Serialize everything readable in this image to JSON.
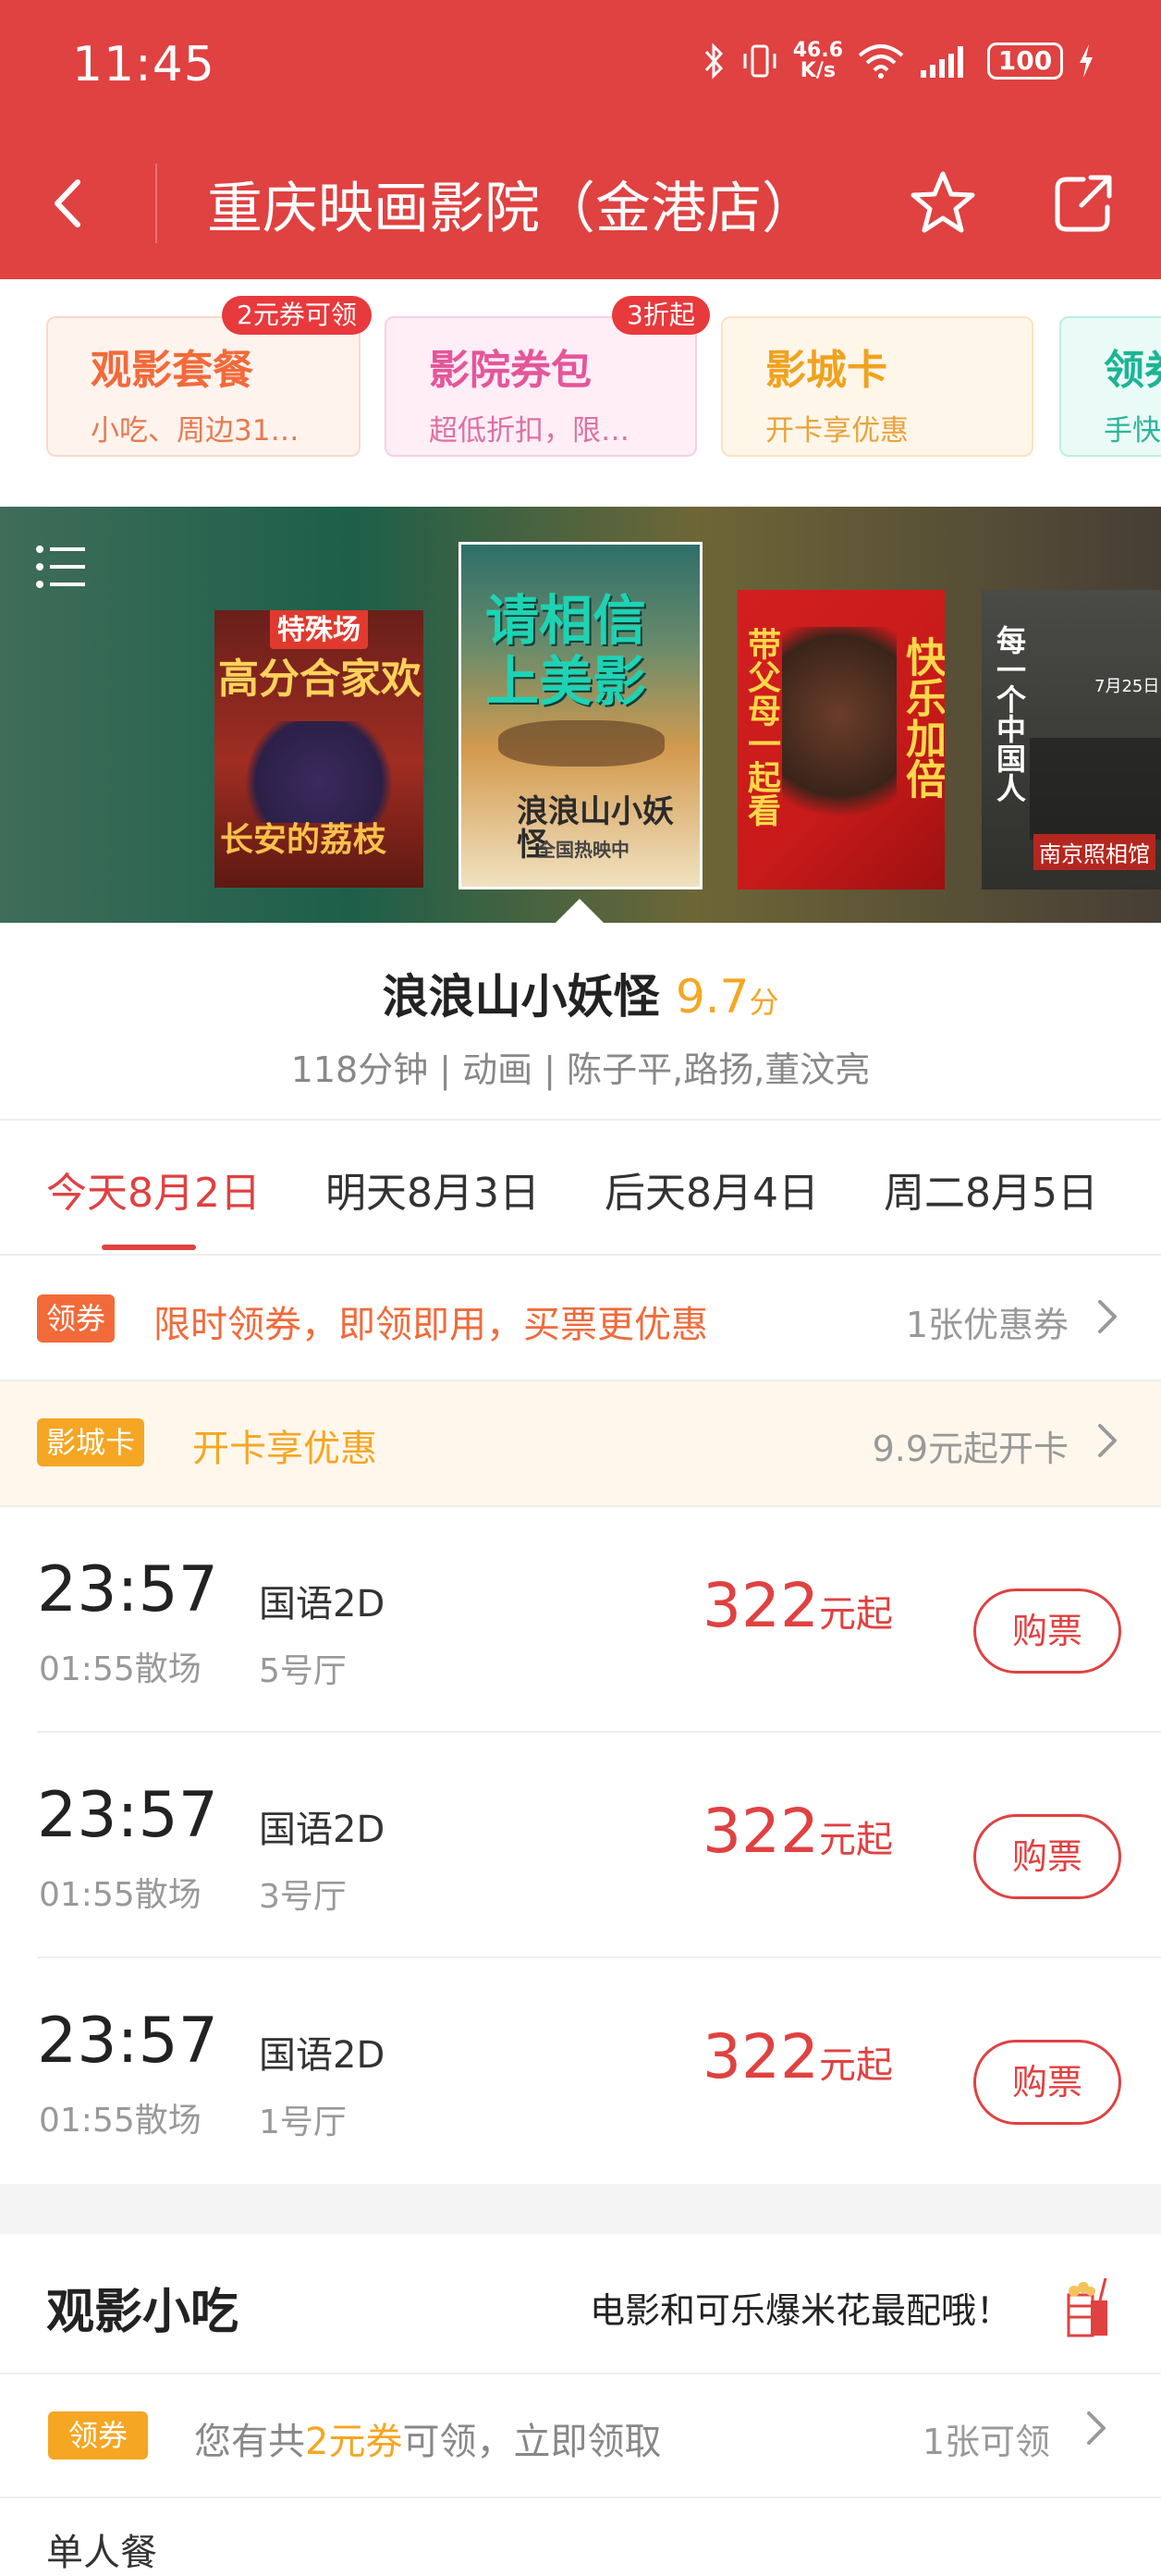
{
  "status": {
    "time": "11:45",
    "net_speed_top": "46.6",
    "net_speed_unit": "K/s",
    "battery": "100"
  },
  "nav": {
    "title": "重庆映画影院（金港店）"
  },
  "promos": [
    {
      "title": "观影套餐",
      "subtitle": "小吃、周边31…",
      "badge": "2元券可领"
    },
    {
      "title": "影院券包",
      "subtitle": "超低折扣，限…",
      "badge": "3折起"
    },
    {
      "title": "影城卡",
      "subtitle": "开卡享优惠"
    },
    {
      "title": "领券",
      "subtitle": "手快"
    }
  ],
  "posters": [
    {
      "tag": "特殊场",
      "title": "高分合家欢",
      "caption": "长安的荔枝"
    },
    {
      "title_line1": "请相信",
      "title_line2": "上美影",
      "caption": "浪浪山小妖怪",
      "sub": "全国热映中"
    },
    {
      "left_text": "带父母一起看",
      "right_text": "快乐加倍"
    },
    {
      "vertical_text": "每一个中国人",
      "date": "7月25日",
      "caption": "南京照相馆"
    }
  ],
  "movie": {
    "title": "浪浪山小妖怪",
    "score": "9.7",
    "score_unit": "分",
    "meta": "118分钟 | 动画 | 陈子平,路扬,董汶亮"
  },
  "dates": [
    "今天8月2日",
    "明天8月3日",
    "后天8月4日",
    "周二8月5日"
  ],
  "coupon_strip": {
    "tag": "领券",
    "text": "限时领券，即领即用，买票更优惠",
    "right": "1张优惠券"
  },
  "card_strip": {
    "tag": "影城卡",
    "text": "开卡享优惠",
    "right": "9.9元起开卡"
  },
  "showtimes": [
    {
      "time": "23:57",
      "end": "01:55散场",
      "lang": "国语2D",
      "hall": "5号厅",
      "price": "322",
      "price_unit": "元起",
      "button": "购票"
    },
    {
      "time": "23:57",
      "end": "01:55散场",
      "lang": "国语2D",
      "hall": "3号厅",
      "price": "322",
      "price_unit": "元起",
      "button": "购票"
    },
    {
      "time": "23:57",
      "end": "01:55散场",
      "lang": "国语2D",
      "hall": "1号厅",
      "price": "322",
      "price_unit": "元起",
      "button": "购票"
    }
  ],
  "snacks": {
    "title": "观影小吃",
    "slogan": "电影和可乐爆米花最配哦！",
    "coupon_tag": "领券",
    "coupon_prefix": "您有共",
    "coupon_amount": "2元券",
    "coupon_suffix": "可领，立即领取",
    "coupon_right": "1张可领",
    "next_item": "单人餐"
  },
  "colors": {
    "brand": "#E04141",
    "score": "#F5A623",
    "card_tag": "#F5A623"
  }
}
